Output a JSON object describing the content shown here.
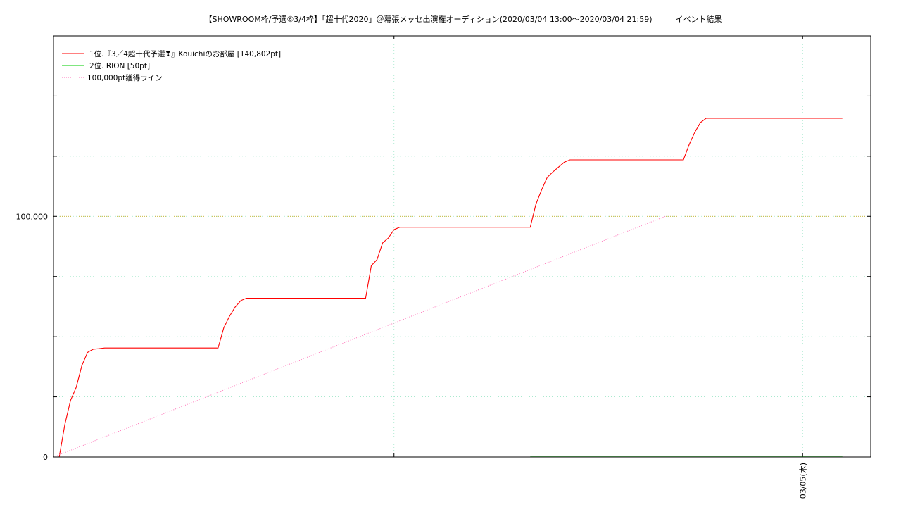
{
  "chart_data": {
    "type": "line",
    "title": "【SHOWROOM枠/予選⑥3/4枠】「超十代2020」＠幕張メッセ出演権オーディション(2020/03/04 13:00〜2020/03/04 21:59)　　　イベント結果",
    "xlabel": "",
    "ylabel": "",
    "xlim": [
      "2020-03-04 13:00",
      "2020-03-05 01:00"
    ],
    "ylim": [
      0,
      175000
    ],
    "y_ticks": [
      {
        "value": 0,
        "label": "0"
      },
      {
        "value": 100000,
        "label": "100,000"
      }
    ],
    "y_minor_ticks": [
      25000,
      50000,
      75000,
      125000,
      150000
    ],
    "x_ticks": [
      {
        "value": "2020-03-05 00:00",
        "label": "03/05(木)"
      }
    ],
    "x_minor_ticks": [
      "2020-03-04 18:00"
    ],
    "grid": true,
    "legend": "top-left",
    "series": [
      {
        "name": "1位.『3／4超十代予選❣』Kouichiのお部屋 [140,802pt]",
        "color": "#ff0000",
        "style": "solid",
        "x": [
          "2020-03-04 13:05",
          "2020-03-04 13:10",
          "2020-03-04 13:15",
          "2020-03-04 13:20",
          "2020-03-04 13:25",
          "2020-03-04 13:30",
          "2020-03-04 13:35",
          "2020-03-04 13:40",
          "2020-03-04 13:45",
          "2020-03-04 15:25",
          "2020-03-04 15:30",
          "2020-03-04 15:35",
          "2020-03-04 15:40",
          "2020-03-04 15:45",
          "2020-03-04 15:50",
          "2020-03-04 15:55",
          "2020-03-04 16:00",
          "2020-03-04 17:35",
          "2020-03-04 17:40",
          "2020-03-04 17:45",
          "2020-03-04 17:50",
          "2020-03-04 17:55",
          "2020-03-04 18:00",
          "2020-03-04 18:05",
          "2020-03-04 20:00",
          "2020-03-04 20:05",
          "2020-03-04 20:10",
          "2020-03-04 20:15",
          "2020-03-04 20:20",
          "2020-03-04 20:25",
          "2020-03-04 20:30",
          "2020-03-04 20:35",
          "2020-03-04 22:15",
          "2020-03-04 22:20",
          "2020-03-04 22:25",
          "2020-03-04 22:30",
          "2020-03-04 22:35",
          "2020-03-05 00:35"
        ],
        "y": [
          0,
          13500,
          23500,
          29000,
          38000,
          43500,
          44800,
          45000,
          45300,
          45300,
          53700,
          58400,
          62300,
          65000,
          66000,
          66000,
          66000,
          66000,
          79500,
          82000,
          89000,
          91000,
          94500,
          95500,
          95500,
          105000,
          111000,
          116200,
          118500,
          120500,
          122500,
          123500,
          123500,
          129800,
          135000,
          139000,
          140802,
          140802
        ]
      },
      {
        "name": "2位. RION [50pt]",
        "color": "#00cc00",
        "style": "solid",
        "x": [
          "2020-03-04 20:00",
          "2020-03-05 00:35"
        ],
        "y": [
          50,
          50
        ]
      },
      {
        "name": "100,000pt獲得ライン",
        "color": "#ff69b4",
        "style": "dotted",
        "x": [
          "2020-03-04 13:00",
          "2020-03-04 21:59"
        ],
        "y": [
          0,
          100000
        ]
      }
    ]
  }
}
